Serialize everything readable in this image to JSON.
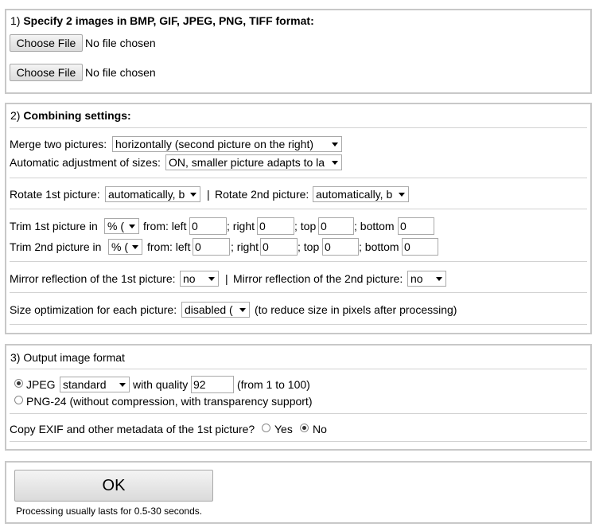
{
  "section1": {
    "number": "1)",
    "title": "Specify 2 images in BMP, GIF, JPEG, PNG, TIFF format:",
    "file_inputs": [
      {
        "button": "Choose File",
        "status": "No file chosen"
      },
      {
        "button": "Choose File",
        "status": "No file chosen"
      }
    ]
  },
  "section2": {
    "number": "2)",
    "title": "Combining settings:",
    "merge_label": "Merge two pictures:",
    "merge_value": "horizontally (second picture on the right)",
    "auto_adjust_label": "Automatic adjustment of sizes:",
    "auto_adjust_value": "ON, smaller picture adapts to la",
    "rotate1_label": "Rotate 1st picture:",
    "rotate1_value": "automatically, b",
    "separator": "|",
    "rotate2_label": "Rotate 2nd picture:",
    "rotate2_value": "automatically, b",
    "trim1": {
      "label": "Trim 1st picture in",
      "unit": "% (",
      "from_left": "from: left",
      "left": "0",
      "right_label": "; right",
      "right": "0",
      "top_label": "; top",
      "top": "0",
      "bottom_label": "; bottom",
      "bottom": "0"
    },
    "trim2": {
      "label": "Trim 2nd picture in",
      "unit": "% (",
      "from_left": "from: left",
      "left": "0",
      "right_label": "; right",
      "right": "0",
      "top_label": "; top",
      "top": "0",
      "bottom_label": "; bottom",
      "bottom": "0"
    },
    "mirror1_label": "Mirror reflection of the 1st picture:",
    "mirror1_value": "no",
    "mirror2_label": "Mirror reflection of the 2nd picture:",
    "mirror2_value": "no",
    "size_opt_label": "Size optimization for each picture:",
    "size_opt_value": "disabled (",
    "size_opt_note": "(to reduce size in pixels after processing)"
  },
  "section3": {
    "title": "3) Output image format",
    "jpeg_label": "JPEG",
    "jpeg_mode": "standard",
    "quality_label": "with quality",
    "quality_value": "92",
    "quality_note": "(from 1 to 100)",
    "png_label": "PNG-24 (without compression, with transparency support)",
    "exif_label": "Copy EXIF and other metadata of the 1st picture?",
    "exif_yes": "Yes",
    "exif_no": "No"
  },
  "submit": {
    "ok_label": "OK",
    "note": "Processing usually lasts for 0.5-30 seconds."
  }
}
